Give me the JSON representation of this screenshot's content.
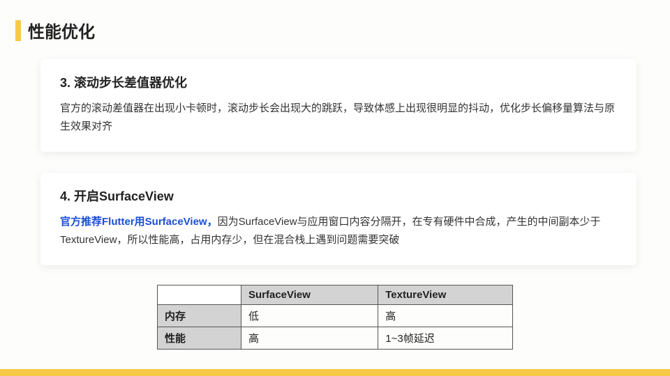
{
  "page_title": "性能优化",
  "card3": {
    "title": "3. 滚动步长差值器优化",
    "body": "官方的滚动差值器在出现小卡顿时，滚动步长会出现大的跳跃，导致体感上出现很明显的抖动，优化步长偏移量算法与原生效果对齐"
  },
  "card4": {
    "title": "4. 开启SurfaceView",
    "highlight": "官方推荐Flutter用SurfaceView，",
    "body_rest": "因为SurfaceView与应用窗口内容分隔开，在专有硬件中合成，产生的中间副本少于TextureView，所以性能高，占用内存少，但在混合栈上遇到问题需要突破"
  },
  "table": {
    "col1": "SurfaceView",
    "col2": "TextureView",
    "rows": [
      {
        "label": "内存",
        "v1": "低",
        "v2": "高"
      },
      {
        "label": "性能",
        "v1": "高",
        "v2": "1~3帧延迟"
      }
    ]
  }
}
